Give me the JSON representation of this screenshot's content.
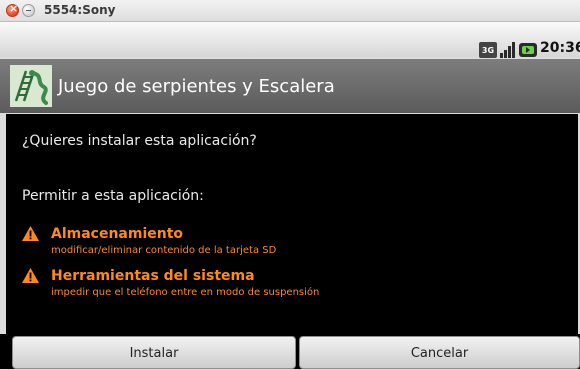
{
  "window": {
    "title": "5554:Sony"
  },
  "status_bar": {
    "network": "3G",
    "time": "20:36"
  },
  "app": {
    "name": "Juego de serpientes y Escalera"
  },
  "dialog": {
    "question": "¿Quieres instalar esta aplicación?",
    "permit_heading": "Permitir a esta aplicación:",
    "permissions": [
      {
        "title": "Almacenamiento",
        "description": "modificar/eliminar contenido de la tarjeta SD"
      },
      {
        "title": "Herramientas del sistema",
        "description": "impedir que el teléfono entre en modo de suspensión"
      }
    ]
  },
  "buttons": {
    "install": "Instalar",
    "cancel": "Cancelar"
  },
  "colors": {
    "warning": "#ff8a1a",
    "background": "#000000"
  }
}
